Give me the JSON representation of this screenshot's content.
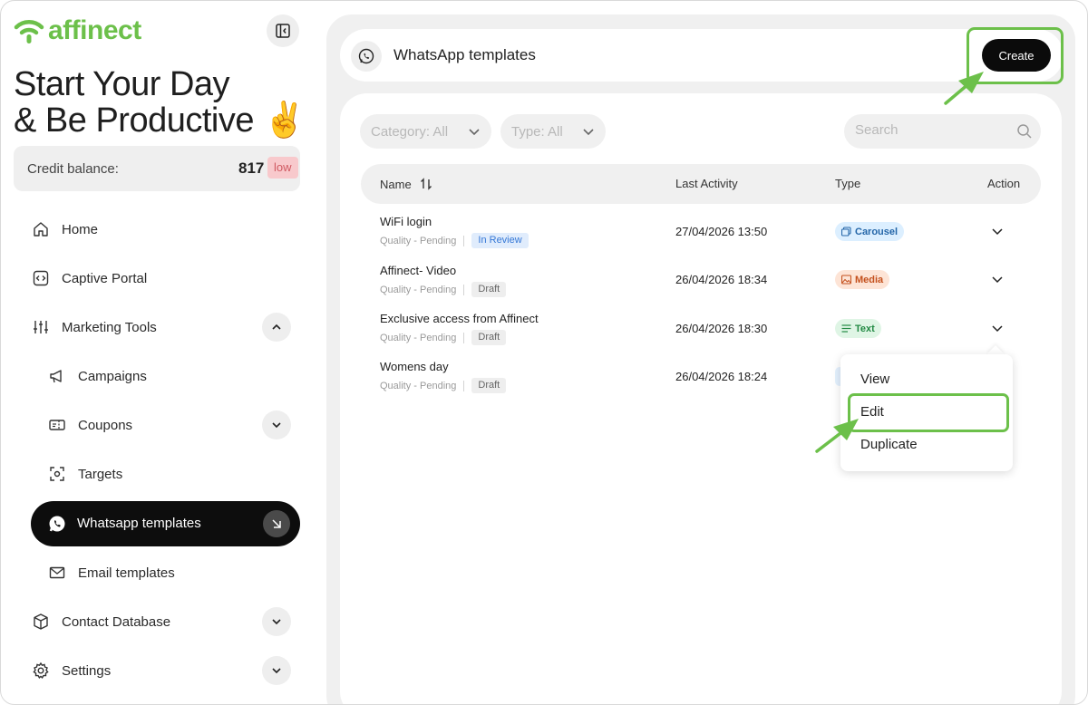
{
  "brand": {
    "name": "affinect",
    "color": "#6cc04a"
  },
  "headline": {
    "line1": "Start Your Day",
    "line2": "& Be Productive ✌️"
  },
  "credit": {
    "label": "Credit balance:",
    "value": "817",
    "badge": "low"
  },
  "sidebar": {
    "items": [
      {
        "label": "Home",
        "icon": "home-icon"
      },
      {
        "label": "Captive Portal",
        "icon": "code-icon"
      },
      {
        "label": "Marketing Tools",
        "icon": "sliders-icon",
        "expanded": true
      },
      {
        "label": "Campaigns",
        "icon": "megaphone-icon"
      },
      {
        "label": "Coupons",
        "icon": "ticket-icon"
      },
      {
        "label": "Targets",
        "icon": "target-icon"
      },
      {
        "label": "Whatsapp templates",
        "icon": "whatsapp-icon",
        "active": true
      },
      {
        "label": "Email templates",
        "icon": "mail-icon"
      },
      {
        "label": "Contact Database",
        "icon": "box-icon"
      },
      {
        "label": "Settings",
        "icon": "gear-icon"
      }
    ]
  },
  "header": {
    "title": "WhatsApp templates",
    "create_label": "Create"
  },
  "filters": {
    "category": "Category: All",
    "type": "Type: All",
    "search_placeholder": "Search"
  },
  "table": {
    "columns": {
      "name": "Name",
      "last_activity": "Last Activity",
      "type": "Type",
      "action": "Action"
    },
    "rows": [
      {
        "name": "WiFi login",
        "quality": "Quality - Pending",
        "status": "In Review",
        "date": "27/04/2026 13:50",
        "type": "Carousel"
      },
      {
        "name": "Affinect- Video",
        "quality": "Quality - Pending",
        "status": "Draft",
        "date": "26/04/2026 18:34",
        "type": "Media"
      },
      {
        "name": "Exclusive access from Affinect",
        "quality": "Quality - Pending",
        "status": "Draft",
        "date": "26/04/2026 18:30",
        "type": "Text"
      },
      {
        "name": "Womens day",
        "quality": "Quality - Pending",
        "status": "Draft",
        "date": "26/04/2026 18:24",
        "type": ""
      }
    ]
  },
  "action_menu": {
    "items": [
      "View",
      "Edit",
      "Duplicate"
    ],
    "highlighted": "Edit"
  },
  "annotation_color": "#6cc04a"
}
